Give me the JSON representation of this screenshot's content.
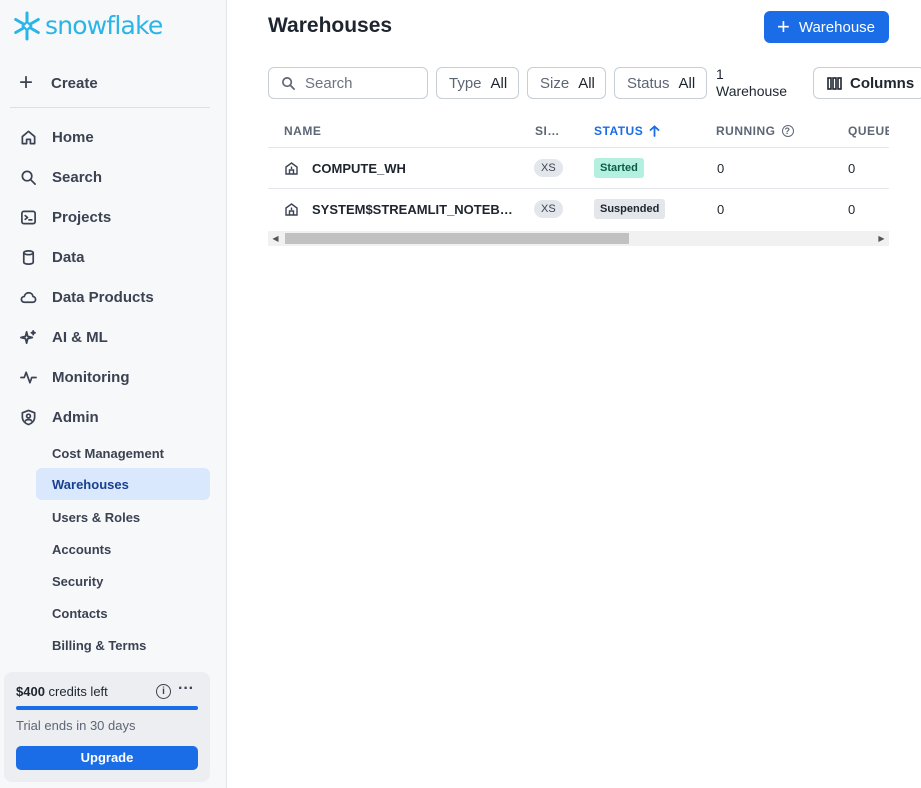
{
  "brand": {
    "name": "snowflake",
    "color": "#29b5e8"
  },
  "sidebar": {
    "create_label": "Create",
    "nav": [
      {
        "label": "Home",
        "icon": "home-icon"
      },
      {
        "label": "Search",
        "icon": "search-icon"
      },
      {
        "label": "Projects",
        "icon": "terminal-icon"
      },
      {
        "label": "Data",
        "icon": "database-icon"
      },
      {
        "label": "Data Products",
        "icon": "cloud-icon"
      },
      {
        "label": "AI & ML",
        "icon": "sparkle-icon"
      },
      {
        "label": "Monitoring",
        "icon": "pulse-icon"
      },
      {
        "label": "Admin",
        "icon": "shield-user-icon"
      }
    ],
    "admin_sub": [
      {
        "label": "Cost Management"
      },
      {
        "label": "Warehouses",
        "active": true
      },
      {
        "label": "Users & Roles"
      },
      {
        "label": "Accounts"
      },
      {
        "label": "Security"
      },
      {
        "label": "Contacts"
      },
      {
        "label": "Billing & Terms"
      }
    ],
    "credits": {
      "amount": "$400",
      "suffix": " credits left",
      "trial": "Trial ends in 30 days",
      "upgrade_label": "Upgrade",
      "remaining_fraction": 1.0
    }
  },
  "main": {
    "title": "Warehouses",
    "add_button_label": "Warehouse",
    "search_placeholder": "Search",
    "filters": [
      {
        "key": "Type",
        "value": "All"
      },
      {
        "key": "Size",
        "value": "All"
      },
      {
        "key": "Status",
        "value": "All"
      }
    ],
    "count_line1": "1",
    "count_line2": "Warehouse",
    "columns_label": "Columns",
    "table": {
      "headers": [
        "NAME",
        "SI…",
        "STATUS",
        "RUNNING",
        "QUEUE"
      ],
      "sorted_column": "STATUS",
      "sort_direction": "ascending",
      "rows": [
        {
          "name": "COMPUTE_WH",
          "size": "XS",
          "status": "Started",
          "running": "0",
          "queued": "0"
        },
        {
          "name": "SYSTEM$STREAMLIT_NOTEB…",
          "size": "XS",
          "status": "Suspended",
          "running": "0",
          "queued": "0"
        }
      ]
    }
  },
  "colors": {
    "accent": "#1a6ce7",
    "active_nav_bg": "#d9e8fd",
    "started_bg": "#b4f0df",
    "started_fg": "#0d5c47",
    "suspended_bg": "#e3e6ea",
    "suspended_fg": "#1e252f"
  }
}
